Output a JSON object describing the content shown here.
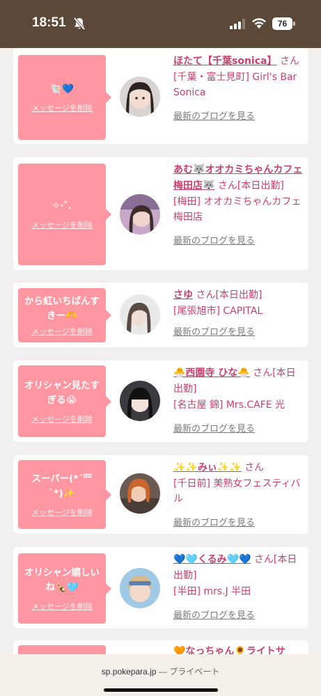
{
  "status_bar": {
    "time": "18:51",
    "battery": "76"
  },
  "messages": [
    {
      "bubble_text": "🐚💙",
      "delete_label": "メッセージを削除",
      "name": "ほたて【千葉sonica】",
      "honorific": "さん",
      "status": "",
      "location": "[千葉・富士見町] Girl's Bar Sonica",
      "blog_label": "最新のブログを見る"
    },
    {
      "bubble_text": "✧‧˚.",
      "delete_label": "メッセージを削除",
      "name": "あむ🐺オオカミちゃんカフェ梅田店🐺",
      "honorific": "さん",
      "status": "[本日出勤]",
      "location": "[梅田] オオカミちゃんカフェ梅田店",
      "blog_label": "最新のブログを見る"
    },
    {
      "bubble_text": "から紅いちばんすきー🫶",
      "delete_label": "メッセージを削除",
      "name": "さゆ",
      "honorific": "さん",
      "status": "[本日出勤]",
      "location": "[尾張旭市] CAPITAL",
      "blog_label": "最新のブログを見る"
    },
    {
      "bubble_text": "オリシャン見たすぎる😭",
      "delete_label": "メッセージを削除",
      "name": "🐣西園寺 ひな🐣",
      "honorific": "さん",
      "status": "[本日出勤]",
      "location": "[名古屋 錦] Mrs.CAFE 光",
      "blog_label": "最新のブログを見る"
    },
    {
      "bubble_text": "スーパー(*´罒`*)✨",
      "delete_label": "メッセージを削除",
      "name": "✨✨みぃ✨✨",
      "honorific": "さん",
      "status": "",
      "location": "[千日前] 美熟女フェスティバル",
      "blog_label": "最新のブログを見る"
    },
    {
      "bubble_text": "オリシャン嬉しいね🍾🩵",
      "delete_label": "メッセージを削除",
      "name": "💙🩵くるみ🩵💙",
      "honorific": "さん",
      "status": "[本日出勤]",
      "location": "[半田] mrs.J 半田",
      "blog_label": "最新のブログを見る"
    },
    {
      "bubble_text": "",
      "delete_label": "",
      "name": "🧡なっちゃん🌻ライトサ",
      "honorific": "",
      "status": "",
      "location": "",
      "blog_label": ""
    }
  ],
  "bottom_bar": {
    "domain": "sp.pokepara.jp",
    "separator": "—",
    "mode": "プライベート"
  },
  "colors": {
    "status_bar_bg": "#5c4837",
    "bubble_bg": "#ff97a2",
    "name_color": "#c8416c",
    "page_bg": "#f1eff0"
  }
}
